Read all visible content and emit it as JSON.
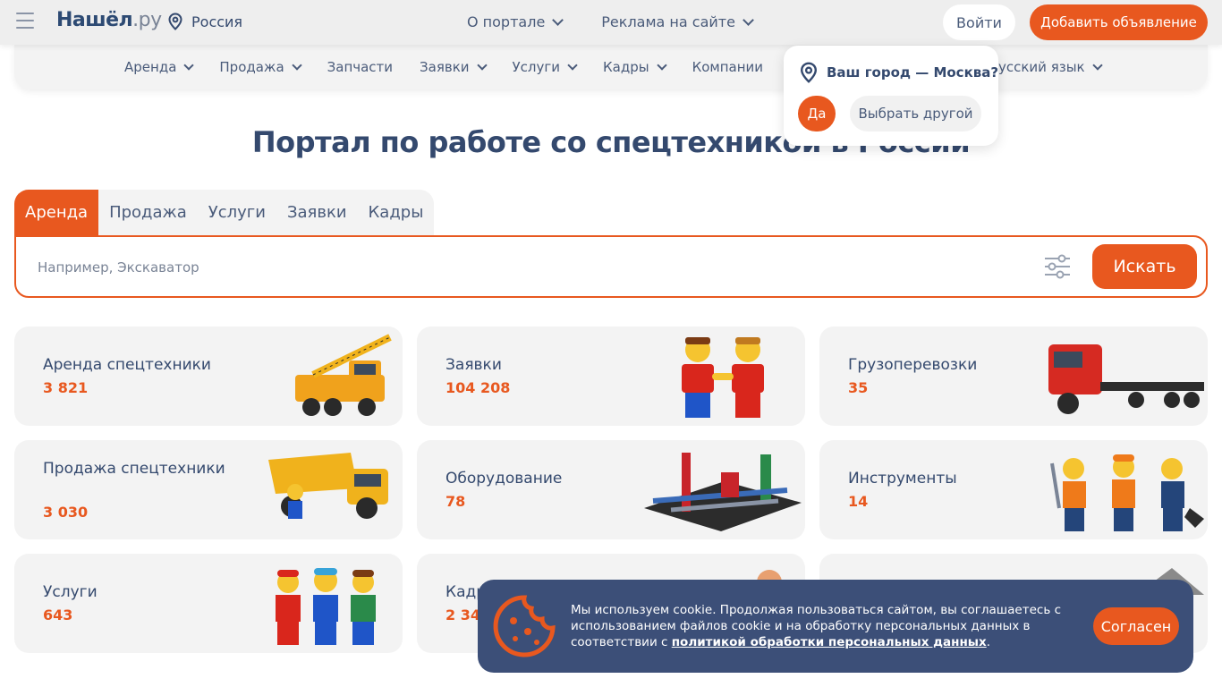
{
  "header": {
    "logo_main": "Нашёл",
    "logo_ru": ".ру",
    "region": "Россия",
    "nav": [
      {
        "label": "О портале"
      },
      {
        "label": "Реклама на сайте"
      }
    ],
    "login_label": "Войти",
    "add_label": "Добавить объявление"
  },
  "catnav": {
    "items": [
      {
        "label": "Аренда",
        "has_dropdown": true
      },
      {
        "label": "Продажа",
        "has_dropdown": true
      },
      {
        "label": "Запчасти",
        "has_dropdown": false
      },
      {
        "label": "Заявки",
        "has_dropdown": true
      },
      {
        "label": "Услуги",
        "has_dropdown": true
      },
      {
        "label": "Кадры",
        "has_dropdown": true
      },
      {
        "label": "Компании",
        "has_dropdown": false
      }
    ],
    "language": "усский язык"
  },
  "city_popup": {
    "question": "Ваш город — Москва?",
    "yes_label": "Да",
    "other_label": "Выбрать другой"
  },
  "main": {
    "title": "Портал по работе со спецтехникой в России"
  },
  "search": {
    "tabs": [
      {
        "label": "Аренда",
        "active": true
      },
      {
        "label": "Продажа",
        "active": false
      },
      {
        "label": "Услуги",
        "active": false
      },
      {
        "label": "Заявки",
        "active": false
      },
      {
        "label": "Кадры",
        "active": false
      }
    ],
    "placeholder": "Например, Экскаватор",
    "button_label": "Искать"
  },
  "categories": [
    {
      "name": "Аренда спецтехники",
      "count": "3 821",
      "icon": "crane-truck-icon"
    },
    {
      "name": "Заявки",
      "count": "104 208",
      "icon": "handshake-figures-icon"
    },
    {
      "name": "Грузоперевозки",
      "count": "35",
      "icon": "semi-truck-icon"
    },
    {
      "name": "Продажа спецтехники",
      "count": "3 030",
      "icon": "dump-truck-icon"
    },
    {
      "name": "Оборудование",
      "count": "78",
      "icon": "machinery-icon"
    },
    {
      "name": "Инструменты",
      "count": "14",
      "icon": "workers-tools-icon"
    },
    {
      "name": "Услуги",
      "count": "643",
      "icon": "team-figures-icon"
    },
    {
      "name": "Кадр",
      "count": "2 34",
      "icon": "worker-icon"
    },
    {
      "name": "",
      "count": "",
      "icon": "gravel-pile-icon"
    }
  ],
  "cookie": {
    "text": "Мы используем cookie. Продолжая пользоваться сайтом, вы соглашаетесь с использованием файлов cookie и на обработку персональных данных в соответствии с",
    "link_label": "политикой обработки персональных данных",
    "link_suffix": ".",
    "agree_label": "Согласен"
  },
  "colors": {
    "accent": "#e8581f",
    "text": "#34496e",
    "card_bg": "#f3f3f3",
    "banner_bg": "#3c4f78"
  }
}
